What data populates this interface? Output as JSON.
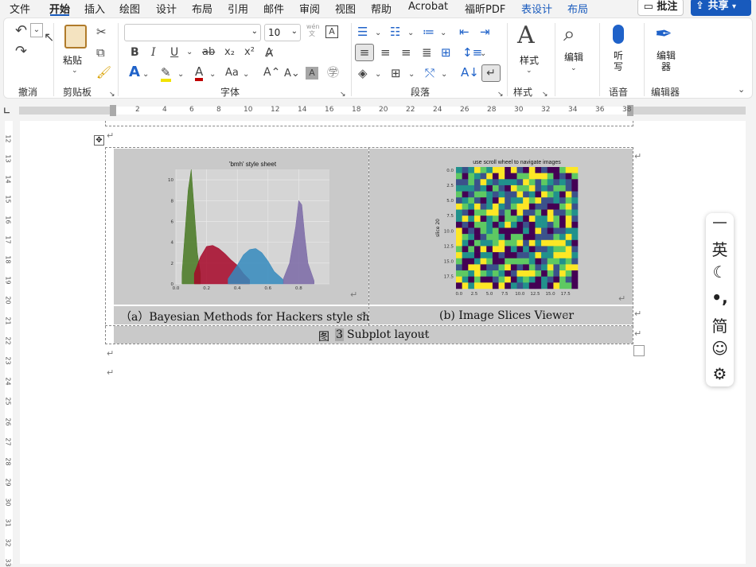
{
  "menu": {
    "items": [
      "文件",
      "开始",
      "插入",
      "绘图",
      "设计",
      "布局",
      "引用",
      "邮件",
      "审阅",
      "视图",
      "帮助",
      "Acrobat",
      "福昕PDF",
      "表设计",
      "布局"
    ],
    "active_index": 1,
    "comment_label": "批注",
    "share_label": "共享"
  },
  "ribbon": {
    "groups": {
      "undo": "撤消",
      "clipboard": "剪贴板",
      "font": "字体",
      "paragraph": "段落",
      "styles": "样式",
      "voice": "语音",
      "editor": "编辑器"
    },
    "paste_label": "粘贴",
    "font_name": "",
    "font_size": "10",
    "styles_button": "样式",
    "edit_button": "编辑",
    "dictate_button": "听写",
    "editor_button": "编辑器",
    "wen_label": "wén 文",
    "font_buttons": [
      "B",
      "I",
      "U",
      "ab",
      "x₂",
      "x²"
    ],
    "case_label": "Aa"
  },
  "ruler": {
    "h_numbers": [
      "2",
      "4",
      "6",
      "8",
      "10",
      "12",
      "14",
      "16",
      "18",
      "20",
      "22",
      "24",
      "26",
      "28",
      "30",
      "32",
      "34",
      "36",
      "38"
    ],
    "v_numbers": [
      "12",
      "13",
      "14",
      "15",
      "16",
      "17",
      "18",
      "19",
      "20",
      "21",
      "22",
      "23",
      "24",
      "25",
      "26",
      "27",
      "28",
      "29",
      "30",
      "31",
      "32",
      "33"
    ]
  },
  "document": {
    "caption_a": "（a）Bayesian Methods for Hackers style sheet",
    "caption_b": "(b) Image Slices Viewer",
    "figure_caption_prefix": "图",
    "figure_number": "3",
    "figure_caption_text": "Subplot layout",
    "para_mark": "↵"
  },
  "chart_data": [
    {
      "type": "area",
      "title": "'bmh' style sheet",
      "xlabel": "",
      "ylabel": "",
      "xlim": [
        0.0,
        1.0
      ],
      "ylim": [
        0,
        11
      ],
      "x_ticks": [
        "0.0",
        "0.2",
        "0.4",
        "0.6",
        "0.8"
      ],
      "y_ticks": [
        "0",
        "2",
        "4",
        "6",
        "8",
        "10"
      ],
      "series": [
        {
          "color": "#467821",
          "x": [
            0.04,
            0.06,
            0.08,
            0.1,
            0.12,
            0.14,
            0.16
          ],
          "values": [
            1,
            5,
            9,
            11,
            7,
            3,
            1
          ]
        },
        {
          "color": "#a60628",
          "x": [
            0.12,
            0.16,
            0.2,
            0.24,
            0.28,
            0.32,
            0.36,
            0.4,
            0.44,
            0.48
          ],
          "values": [
            1,
            2.6,
            3.6,
            3.7,
            3.4,
            2.9,
            2.3,
            1.8,
            1.0,
            0.4
          ]
        },
        {
          "color": "#348abd",
          "x": [
            0.34,
            0.4,
            0.44,
            0.48,
            0.52,
            0.56,
            0.6,
            0.64,
            0.7
          ],
          "values": [
            0.5,
            1.8,
            2.8,
            3.3,
            3.4,
            3.0,
            2.2,
            1.2,
            0.4
          ]
        },
        {
          "color": "#7a68a6",
          "x": [
            0.7,
            0.74,
            0.78,
            0.8,
            0.82,
            0.84,
            0.86,
            0.9
          ],
          "values": [
            0.5,
            2.0,
            5.5,
            8.0,
            7.6,
            4.5,
            2.0,
            0.3
          ]
        }
      ]
    },
    {
      "type": "heatmap",
      "title": "use scroll wheel to navigate images",
      "ylabel": "slice 20",
      "x_ticks": [
        "0.0",
        "2.5",
        "5.0",
        "7.5",
        "10.0",
        "12.5",
        "15.0",
        "17.5"
      ],
      "y_ticks": [
        "0.0",
        "2.5",
        "5.0",
        "7.5",
        "10.0",
        "12.5",
        "15.0",
        "17.5"
      ],
      "grid": [
        20,
        20
      ],
      "colormap": "viridis",
      "palette": [
        "#440154",
        "#3b528b",
        "#21918c",
        "#5ec962",
        "#fde725"
      ]
    }
  ],
  "ime": {
    "items": [
      "英",
      "☾",
      "•,",
      "简",
      "☺",
      "⚙"
    ]
  }
}
